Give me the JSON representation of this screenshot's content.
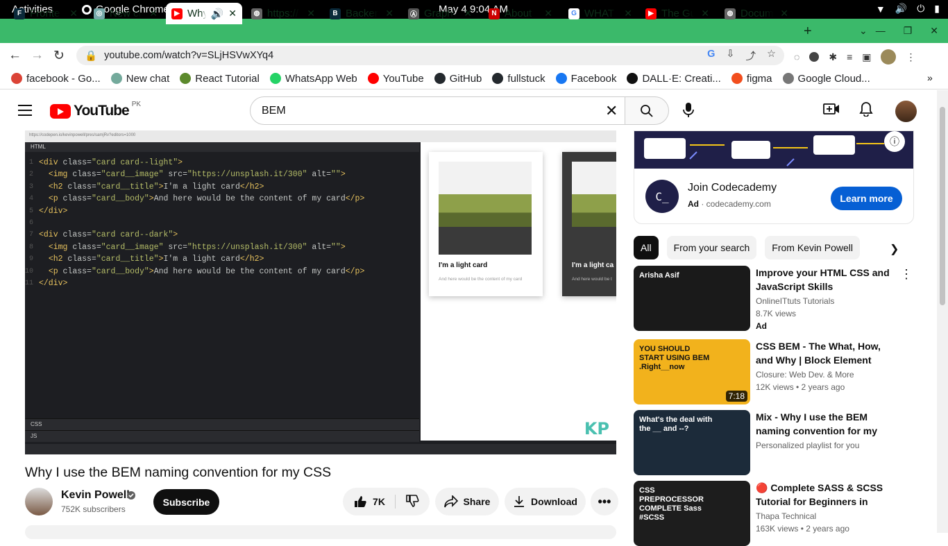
{
  "system_bar": {
    "activities": "Activities",
    "app": "Google Chrome",
    "clock": "May 4  9:04 AM"
  },
  "tabs": [
    {
      "title": "Fronte",
      "color": "#0b2a3a",
      "glyph": "F"
    },
    {
      "title": "New ch",
      "color": "#7aa",
      "glyph": "◎"
    },
    {
      "title": "Why",
      "color": "#f00",
      "glyph": "▶",
      "active": true
    },
    {
      "title": "https://",
      "color": "#666",
      "glyph": "◍"
    },
    {
      "title": "Backen",
      "color": "#0b2a3a",
      "glyph": "B"
    },
    {
      "title": "GraphQ",
      "color": "#555",
      "glyph": "Ⓐ"
    },
    {
      "title": "About",
      "color": "#c00",
      "glyph": "N"
    },
    {
      "title": "WHAT I",
      "color": "#fff",
      "glyph": "G"
    },
    {
      "title": "The Gu",
      "color": "#f00",
      "glyph": "▶"
    },
    {
      "title": "Docum",
      "color": "#666",
      "glyph": "◍"
    }
  ],
  "address_bar": {
    "url": "youtube.com/watch?v=SLjHSVwXYq4"
  },
  "bookmarks": [
    {
      "label": "facebook - Go...",
      "color": "#db4437"
    },
    {
      "label": "New chat",
      "color": "#74aa9c"
    },
    {
      "label": "React Tutorial",
      "color": "#5c8a2d"
    },
    {
      "label": "WhatsApp Web",
      "color": "#25d366"
    },
    {
      "label": "YouTube",
      "color": "#f00"
    },
    {
      "label": "GitHub",
      "color": "#24292e"
    },
    {
      "label": "fullstuck",
      "color": "#24292e"
    },
    {
      "label": "Facebook",
      "color": "#1877f2"
    },
    {
      "label": "DALL·E: Creati...",
      "color": "#111"
    },
    {
      "label": "figma",
      "color": "#f24e1e"
    },
    {
      "label": "Google Cloud...",
      "color": "#777"
    }
  ],
  "youtube": {
    "logo": "YouTube",
    "region": "PK",
    "search_value": "BEM"
  },
  "video": {
    "panel_html": "HTML",
    "panel_css": "CSS",
    "panel_js": "JS",
    "code": [
      [
        [
          "tg",
          "<div "
        ],
        [
          "at",
          "class="
        ],
        [
          "st",
          "\"card card--light\""
        ],
        [
          "tg",
          ">"
        ]
      ],
      [
        [
          "tx",
          "  "
        ],
        [
          "tg",
          "<img "
        ],
        [
          "at",
          "class="
        ],
        [
          "st",
          "\"card__image\""
        ],
        [
          "at",
          " src="
        ],
        [
          "st",
          "\"https://unsplash.it/300\""
        ],
        [
          "at",
          " alt="
        ],
        [
          "st",
          "\"\""
        ],
        [
          "tg",
          ">"
        ]
      ],
      [
        [
          "tx",
          "  "
        ],
        [
          "tg",
          "<h2 "
        ],
        [
          "at",
          "class="
        ],
        [
          "st",
          "\"card__title\""
        ],
        [
          "tg",
          ">"
        ],
        [
          "tx",
          "I'm a light card"
        ],
        [
          "tg",
          "</h2>"
        ]
      ],
      [
        [
          "tx",
          "  "
        ],
        [
          "tg",
          "<p "
        ],
        [
          "at",
          "class="
        ],
        [
          "st",
          "\"card__body\""
        ],
        [
          "tg",
          ">"
        ],
        [
          "tx",
          "And here would be the content of my card"
        ],
        [
          "tg",
          "</p>"
        ]
      ],
      [
        [
          "tg",
          "</div>"
        ]
      ],
      [],
      [
        [
          "tg",
          "<div "
        ],
        [
          "at",
          "class="
        ],
        [
          "st",
          "\"card card--dark\""
        ],
        [
          "tg",
          ">"
        ]
      ],
      [
        [
          "tx",
          "  "
        ],
        [
          "tg",
          "<img "
        ],
        [
          "at",
          "class="
        ],
        [
          "st",
          "\"card__image\""
        ],
        [
          "at",
          " src="
        ],
        [
          "st",
          "\"https://unsplash.it/300\""
        ],
        [
          "at",
          " alt="
        ],
        [
          "st",
          "\"\""
        ],
        [
          "tg",
          ">"
        ]
      ],
      [
        [
          "tx",
          "  "
        ],
        [
          "tg",
          "<h2 "
        ],
        [
          "at",
          "class="
        ],
        [
          "st",
          "\"card__title\""
        ],
        [
          "tg",
          ">"
        ],
        [
          "tx",
          "I'm a light card"
        ],
        [
          "tg",
          "</h2>"
        ]
      ],
      [
        [
          "tx",
          "  "
        ],
        [
          "tg",
          "<p "
        ],
        [
          "at",
          "class="
        ],
        [
          "st",
          "\"card__body\""
        ],
        [
          "tg",
          ">"
        ],
        [
          "tx",
          "And here would be the content of my card"
        ],
        [
          "tg",
          "</p>"
        ]
      ],
      [
        [
          "tg",
          "</div>"
        ]
      ]
    ],
    "card_light_title": "I'm a light card",
    "card_light_body": "And here would be the content of my card",
    "card_dark_title": "I'm a light ca",
    "card_dark_body": "And here would be t",
    "watermark": "KP",
    "title": "Why I use the BEM naming convention for my CSS"
  },
  "channel": {
    "name": "Kevin Powell",
    "subscribers": "752K subscribers",
    "subscribe_label": "Subscribe"
  },
  "actions": {
    "likes": "7K",
    "share": "Share",
    "download": "Download"
  },
  "ad": {
    "title": "Join Codecademy",
    "badge": "Ad",
    "domain": "codecademy.com",
    "cta": "Learn more",
    "logo": "C_"
  },
  "chips": [
    "All",
    "From your search",
    "From Kevin Powell"
  ],
  "recommendations": [
    {
      "title": "Improve your HTML CSS and JavaScript Skills",
      "channel": "OnlineITtuts Tutorials",
      "views": "8.7K views",
      "badge": "Ad",
      "thumb_bg": "#1a1a1a",
      "thumb_text": "Arisha Asif"
    },
    {
      "title": "CSS BEM - The What, How, and Why | Block Element Modifier...",
      "channel": "Closure: Web Dev. & More",
      "views": "12K views  • 2 years ago",
      "duration": "7:18",
      "thumb_bg": "#f2b21c",
      "thumb_text": "YOU SHOULD START USING BEM .Right__now"
    },
    {
      "title": "Mix - Why I use the BEM naming convention for my CSS",
      "channel": "Personalized playlist for you",
      "views": "",
      "thumb_bg": "#1c2b3a",
      "thumb_text": "What's the deal with the __ and --?"
    },
    {
      "title": "🔴 Complete SASS & SCSS Tutorial for Beginners in Hindi ...",
      "channel": "Thapa Technical",
      "views": "163K views  • 2 years ago",
      "thumb_bg": "#1d1d1d",
      "thumb_text": "CSS PREPROCESSOR COMPLETE Sass #SCSS"
    }
  ]
}
